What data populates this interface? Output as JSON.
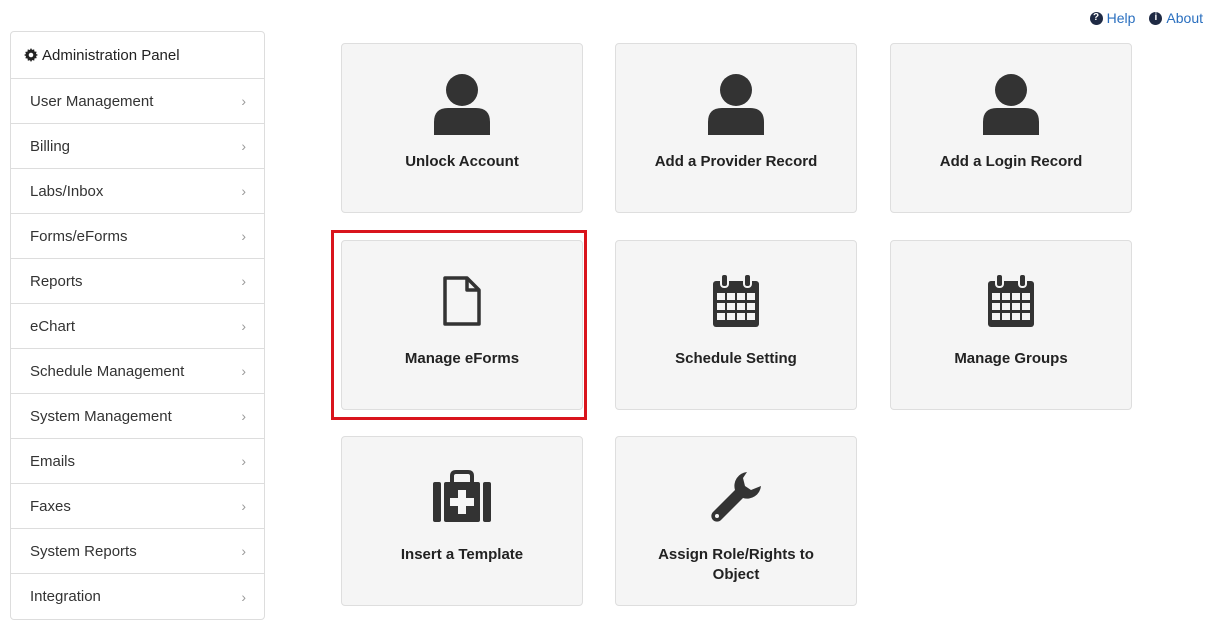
{
  "top_links": {
    "help_label": "Help",
    "about_label": "About"
  },
  "sidebar": {
    "header": "Administration Panel",
    "items": [
      {
        "label": "User Management"
      },
      {
        "label": "Billing"
      },
      {
        "label": "Labs/Inbox"
      },
      {
        "label": "Forms/eForms"
      },
      {
        "label": "Reports"
      },
      {
        "label": "eChart"
      },
      {
        "label": "Schedule Management"
      },
      {
        "label": "System Management"
      },
      {
        "label": "Emails"
      },
      {
        "label": "Faxes"
      },
      {
        "label": "System Reports"
      },
      {
        "label": "Integration"
      }
    ]
  },
  "tiles": [
    {
      "label": "Unlock Account",
      "icon": "user-icon"
    },
    {
      "label": "Add a Provider Record",
      "icon": "user-icon"
    },
    {
      "label": "Add a Login Record",
      "icon": "user-icon"
    },
    {
      "label": "Manage eForms",
      "icon": "file-icon"
    },
    {
      "label": "Schedule Setting",
      "icon": "calendar-icon"
    },
    {
      "label": "Manage Groups",
      "icon": "calendar-icon"
    },
    {
      "label": "Insert a Template",
      "icon": "medkit-icon"
    },
    {
      "label": "Assign Role/Rights to Object",
      "icon": "wrench-icon"
    }
  ],
  "colors": {
    "link": "#2a6fbf",
    "tile_bg": "#f5f5f5",
    "highlight": "#d9141c",
    "icon": "#333333"
  }
}
